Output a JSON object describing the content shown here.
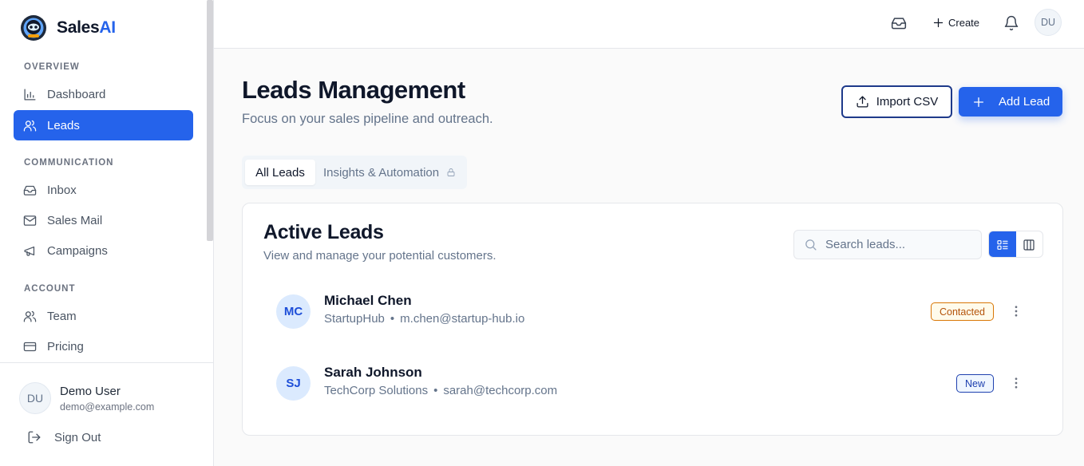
{
  "app": {
    "logo_name": "Sales",
    "logo_suffix": "AI"
  },
  "sidebar": {
    "sections": [
      {
        "title": "OVERVIEW",
        "items": [
          {
            "label": "Dashboard",
            "icon": "bar-chart-icon"
          },
          {
            "label": "Leads",
            "icon": "users-icon",
            "active": true
          }
        ]
      },
      {
        "title": "COMMUNICATION",
        "items": [
          {
            "label": "Inbox",
            "icon": "inbox-icon"
          },
          {
            "label": "Sales Mail",
            "icon": "mail-icon"
          },
          {
            "label": "Campaigns",
            "icon": "megaphone-icon"
          }
        ]
      },
      {
        "title": "ACCOUNT",
        "items": [
          {
            "label": "Team",
            "icon": "users-icon"
          },
          {
            "label": "Pricing",
            "icon": "credit-card-icon"
          }
        ]
      }
    ],
    "user": {
      "initials": "DU",
      "name": "Demo User",
      "email": "demo@example.com"
    },
    "sign_out": "Sign Out"
  },
  "topbar": {
    "create_label": "Create",
    "avatar_initials": "DU"
  },
  "main": {
    "title": "Leads Management",
    "subtitle": "Focus on your sales pipeline and outreach.",
    "import_label": "Import CSV",
    "add_label": "Add Lead",
    "tabs": [
      {
        "label": "All Leads",
        "active": true
      },
      {
        "label": "Insights & Automation",
        "locked": true
      }
    ],
    "card": {
      "title": "Active Leads",
      "subtitle": "View and manage your potential customers.",
      "search_placeholder": "Search leads...",
      "leads": [
        {
          "initials": "MC",
          "name": "Michael Chen",
          "company": "StartupHub",
          "separator": "•",
          "email": "m.chen@startup-hub.io",
          "status": "Contacted"
        },
        {
          "initials": "SJ",
          "name": "Sarah Johnson",
          "company": "TechCorp Solutions",
          "separator": "•",
          "email": "sarah@techcorp.com",
          "status": "New"
        }
      ]
    }
  },
  "colors": {
    "accent": "#2563eb",
    "contacted": "#d97706",
    "new": "#1e40af"
  }
}
